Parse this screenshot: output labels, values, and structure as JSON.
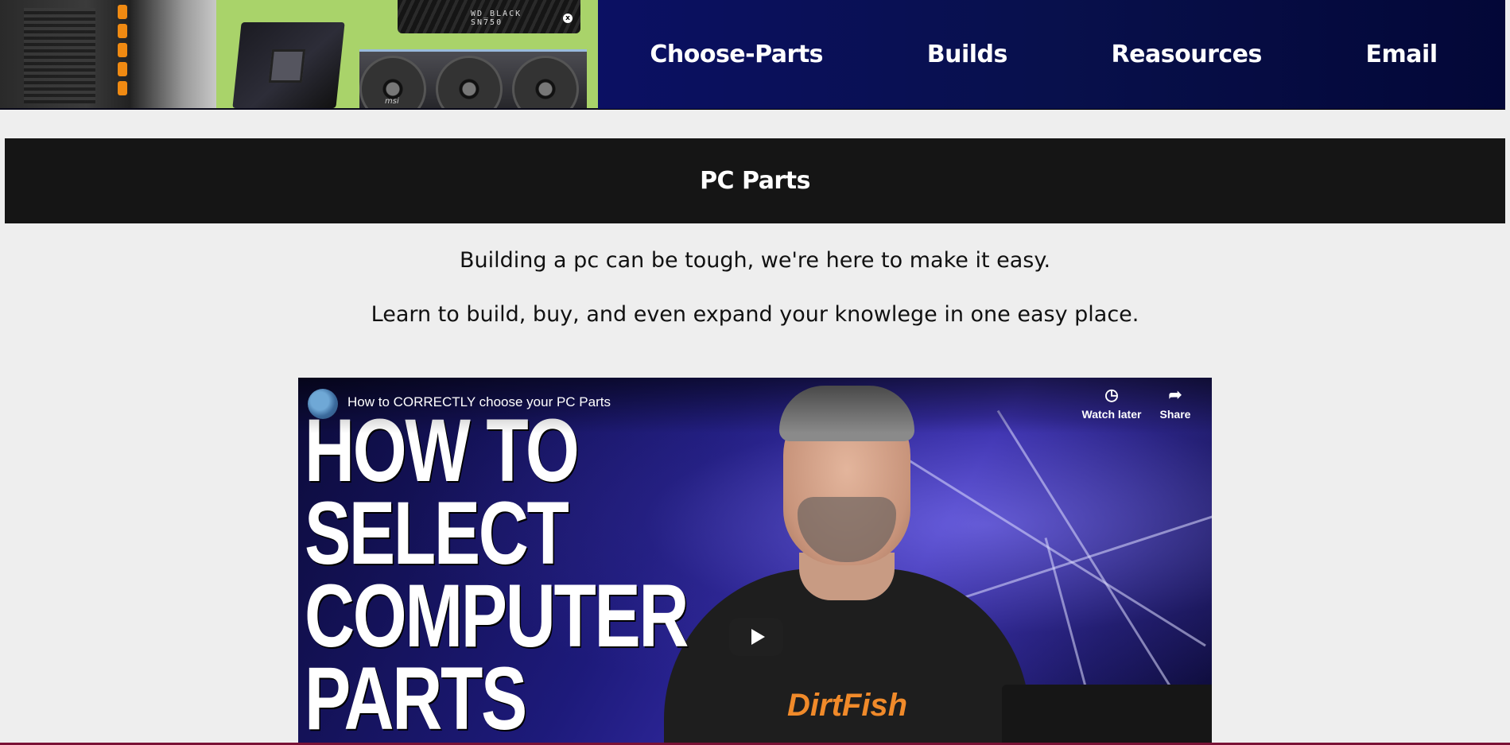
{
  "header": {
    "hero_image": {
      "ssd_label_line1": "WD_BLACK",
      "ssd_label_line2": "SN750",
      "gpu_brand": "msi"
    },
    "nav": [
      {
        "label": "Choose-Parts"
      },
      {
        "label": "Builds"
      },
      {
        "label": "Reasources"
      },
      {
        "label": "Email"
      }
    ]
  },
  "banner": {
    "title": "PC Parts"
  },
  "intro": {
    "line1": "Building a pc can be tough, we're here to make it easy.",
    "line2": "Learn to build, buy, and even expand your knowlege in one easy place."
  },
  "video": {
    "title": "How to CORRECTLY choose your PC Parts",
    "watch_later_label": "Watch later",
    "share_label": "Share",
    "thumbnail_text": [
      "HOW TO",
      "SELECT",
      "COMPUTER",
      "PARTS"
    ],
    "shirt_logo": "DirtFish"
  },
  "colors": {
    "page_bg": "#eeeeee",
    "nav_bg": "#08104c",
    "banner_bg": "#151515",
    "nav_text": "#ffffff"
  }
}
